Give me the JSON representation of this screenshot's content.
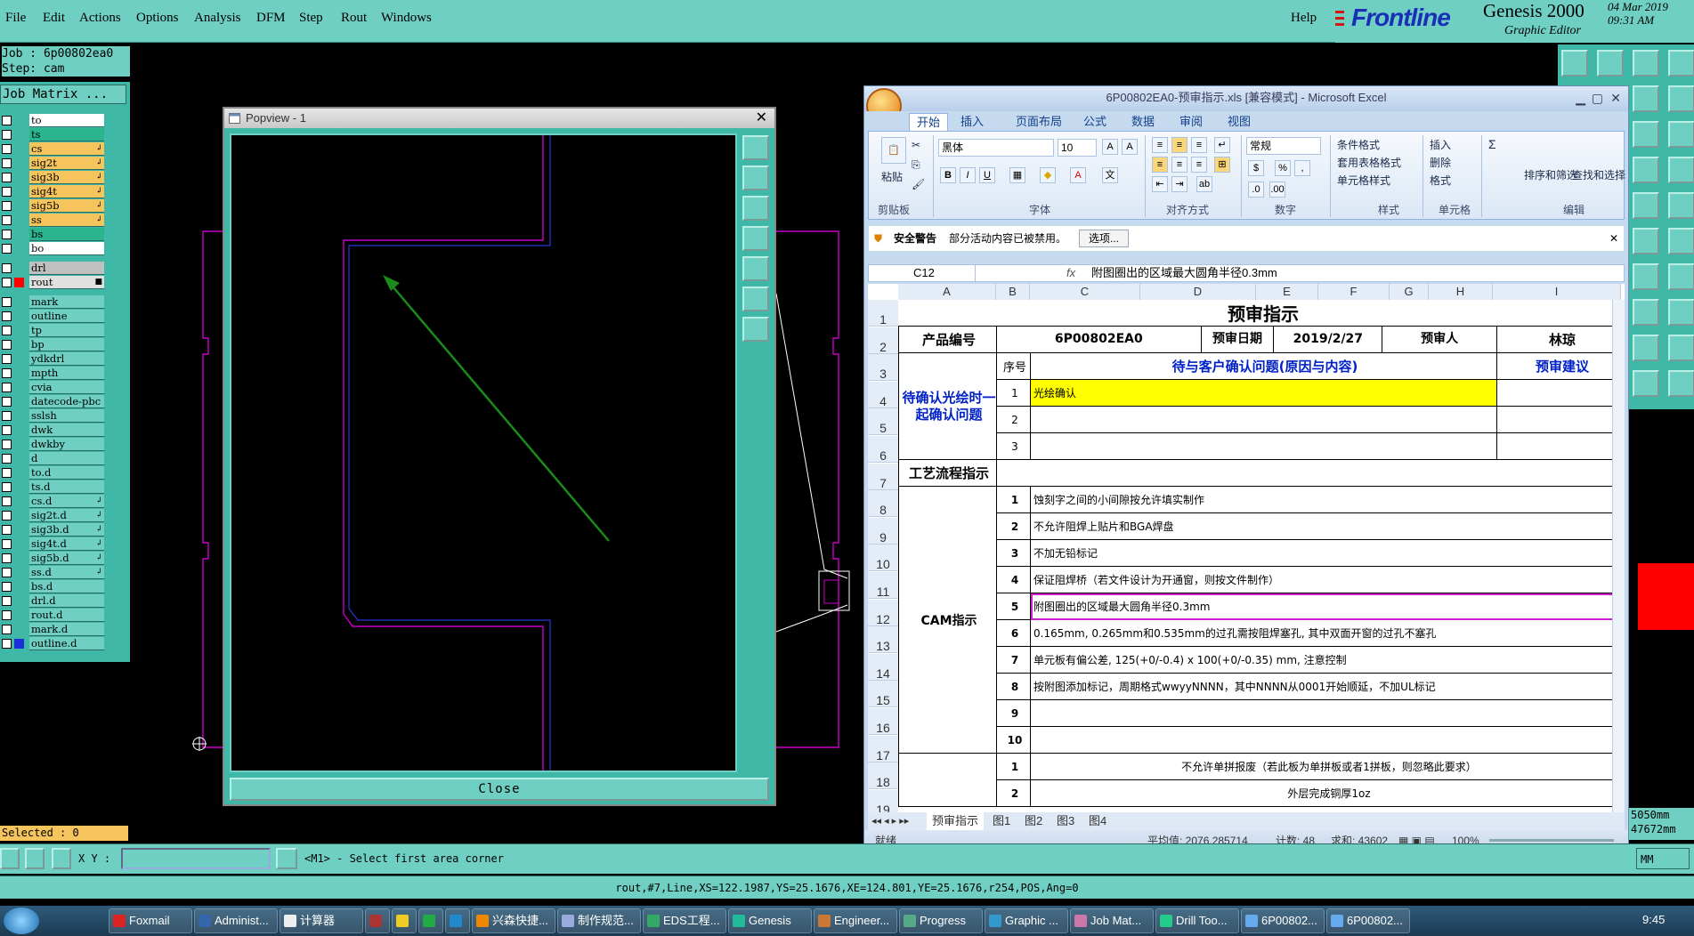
{
  "menubar": {
    "items": [
      "File",
      "Edit",
      "Actions",
      "Options",
      "Analysis",
      "DFM",
      "Step",
      "Rout",
      "Windows"
    ],
    "help": "Help"
  },
  "brand": {
    "frontline": "Frontline",
    "genesis": "Genesis 2000",
    "subtitle": "Graphic Editor",
    "date": "04 Mar 2019",
    "time": "09:31 AM"
  },
  "job": {
    "job_label": "Job : 6p00802ea0",
    "step_label": "Step: cam",
    "matrix_button": "Job Matrix ..."
  },
  "layers": [
    {
      "name": "to",
      "color": "#ffffff",
      "flag": ""
    },
    {
      "name": "ts",
      "color": "#2bb58f",
      "flag": ""
    },
    {
      "name": "cs",
      "color": "#f5c45c",
      "flag": "↲"
    },
    {
      "name": "sig2t",
      "color": "#f5c45c",
      "flag": "↲"
    },
    {
      "name": "sig3b",
      "color": "#f5c45c",
      "flag": "↲"
    },
    {
      "name": "sig4t",
      "color": "#f5c45c",
      "flag": "↲"
    },
    {
      "name": "sig5b",
      "color": "#f5c45c",
      "flag": "↲"
    },
    {
      "name": "ss",
      "color": "#f5c45c",
      "flag": "↲"
    },
    {
      "name": "bs",
      "color": "#2bb58f",
      "flag": ""
    },
    {
      "name": "bo",
      "color": "#ffffff",
      "flag": ""
    },
    {
      "name": "drl",
      "color": "#c0c0c0",
      "flag": ""
    },
    {
      "name": "rout",
      "color": "#e0e0e0",
      "flag": "■"
    },
    {
      "name": "mark",
      "color": "#6ecfc2",
      "flag": ""
    },
    {
      "name": "outline",
      "color": "#6ecfc2",
      "flag": ""
    },
    {
      "name": "tp",
      "color": "#6ecfc2",
      "flag": ""
    },
    {
      "name": "bp",
      "color": "#6ecfc2",
      "flag": ""
    },
    {
      "name": "ydkdrl",
      "color": "#6ecfc2",
      "flag": ""
    },
    {
      "name": "mpth",
      "color": "#6ecfc2",
      "flag": ""
    },
    {
      "name": "cvia",
      "color": "#6ecfc2",
      "flag": ""
    },
    {
      "name": "datecode-pbc",
      "color": "#6ecfc2",
      "flag": ""
    },
    {
      "name": "sslsh",
      "color": "#6ecfc2",
      "flag": ""
    },
    {
      "name": "dwk",
      "color": "#6ecfc2",
      "flag": ""
    },
    {
      "name": "dwkby",
      "color": "#6ecfc2",
      "flag": ""
    },
    {
      "name": "d",
      "color": "#6ecfc2",
      "flag": ""
    },
    {
      "name": "to.d",
      "color": "#6ecfc2",
      "flag": ""
    },
    {
      "name": "ts.d",
      "color": "#6ecfc2",
      "flag": ""
    },
    {
      "name": "cs.d",
      "color": "#6ecfc2",
      "flag": "↲"
    },
    {
      "name": "sig2t.d",
      "color": "#6ecfc2",
      "flag": "↲"
    },
    {
      "name": "sig3b.d",
      "color": "#6ecfc2",
      "flag": "↲"
    },
    {
      "name": "sig4t.d",
      "color": "#6ecfc2",
      "flag": "↲"
    },
    {
      "name": "sig5b.d",
      "color": "#6ecfc2",
      "flag": "↲"
    },
    {
      "name": "ss.d",
      "color": "#6ecfc2",
      "flag": "↲"
    },
    {
      "name": "bs.d",
      "color": "#6ecfc2",
      "flag": ""
    },
    {
      "name": "drl.d",
      "color": "#6ecfc2",
      "flag": ""
    },
    {
      "name": "rout.d",
      "color": "#6ecfc2",
      "flag": ""
    },
    {
      "name": "mark.d",
      "color": "#6ecfc2",
      "flag": ""
    },
    {
      "name": "outline.d",
      "color": "#6ecfc2",
      "flag": ""
    }
  ],
  "selected": "Selected : 0",
  "popview": {
    "title": "Popview - 1",
    "close_button": "Close"
  },
  "excel": {
    "title": "6P00802EA0-预审指示.xls  [兼容模式]  -  Microsoft Excel",
    "tabs": [
      "开始",
      "插入",
      "页面布局",
      "公式",
      "数据",
      "审阅",
      "视图"
    ],
    "ribbon": {
      "paste": "粘贴",
      "clipboard": "剪贴板",
      "font_name": "黑体",
      "font_size": "10",
      "font_group": "字体",
      "align_group": "对齐方式",
      "number_format": "常规",
      "number_group": "数字",
      "cond_format": "条件格式",
      "table_format": "套用表格格式",
      "cell_style": "单元格样式",
      "style_group": "样式",
      "insert": "插入",
      "delete": "删除",
      "format": "格式",
      "cells_group": "单元格",
      "sort_filter": "排序和筛选",
      "find_select": "查找和选择",
      "edit_group": "编辑"
    },
    "security": {
      "label": "安全警告",
      "message": "部分活动内容已被禁用。",
      "options_button": "选项..."
    },
    "name_box": "C12",
    "formula": "附图圈出的区域最大圆角半径0.3mm",
    "columns": [
      "A",
      "B",
      "C",
      "D",
      "E",
      "F",
      "G",
      "H",
      "I"
    ],
    "sheet": {
      "title": "预审指示",
      "product_label": "产品编号",
      "product_value": "6P00802EA0",
      "date_label": "预审日期",
      "date_value": "2019/2/27",
      "reviewer_label": "预审人",
      "reviewer_value": "林琼",
      "seq_header": "序号",
      "issue_header": "待与客户确认问题(原因与内容)",
      "suggest_header": "预审建议",
      "pending_label": "待确认光绘时一起确认问题",
      "pending_rows": [
        {
          "n": "1",
          "text": "光绘确认"
        },
        {
          "n": "2",
          "text": ""
        },
        {
          "n": "3",
          "text": ""
        }
      ],
      "process_label": "工艺流程指示",
      "cam_label": "CAM指示",
      "cam_rows": [
        {
          "n": "1",
          "text": "蚀刻字之间的小间隙按允许填实制作"
        },
        {
          "n": "2",
          "text": "不允许阻焊上贴片和BGA焊盘"
        },
        {
          "n": "3",
          "text": "不加无铅标记"
        },
        {
          "n": "4",
          "text": "保证阻焊桥（若文件设计为开通窗，则按文件制作）"
        },
        {
          "n": "5",
          "text": "附图圈出的区域最大圆角半径0.3mm"
        },
        {
          "n": "6",
          "text": "0.165mm, 0.265mm和0.535mm的过孔需按阻焊塞孔, 其中双面开窗的过孔不塞孔"
        },
        {
          "n": "7",
          "text": "单元板有偏公差, 125(+0/-0.4) x 100(+0/-0.35) mm, 注意控制"
        },
        {
          "n": "8",
          "text": "按附图添加标记，周期格式wwyyNNNN，其中NNNN从0001开始顺延，不加UL标记"
        },
        {
          "n": "9",
          "text": ""
        },
        {
          "n": "10",
          "text": ""
        }
      ],
      "extra_rows": [
        {
          "n": "1",
          "text": "不允许单拼报废（若此板为单拼板或者1拼板，则忽略此要求）"
        },
        {
          "n": "2",
          "text": "外层完成铜厚1oz"
        }
      ],
      "row_numbers": [
        "1",
        "2",
        "3",
        "4",
        "5",
        "6",
        "7",
        "8",
        "9",
        "10",
        "11",
        "12",
        "13",
        "14",
        "15",
        "16",
        "17",
        "18",
        "19"
      ]
    },
    "sheet_tabs": [
      "预审指示",
      "图1",
      "图2",
      "图3",
      "图4"
    ],
    "status": {
      "ready": "就绪",
      "average": "平均值: 2076.285714",
      "count": "计数: 48",
      "sum": "求和: 43602",
      "zoom": "100%"
    }
  },
  "right_status": {
    "line1": "5050mm",
    "line2": "47672mm"
  },
  "command": {
    "xy_label": "X Y :",
    "xy_value": "",
    "prompt": "<M1> - Select first area corner",
    "units": "MM"
  },
  "info_line": "rout,#7,Line,XS=122.1987,YS=25.1676,XE=124.801,YE=25.1676,r254,POS,Ang=0",
  "taskbar": {
    "items": [
      "Foxmail",
      "Administ...",
      "计算器",
      "",
      "",
      "",
      "",
      "兴森快捷...",
      "制作规范...",
      "EDS工程...",
      "Genesis",
      "Engineer...",
      "Progress",
      "Graphic ...",
      "Job Mat...",
      "Drill Too...",
      "6P00802...",
      "6P00802..."
    ],
    "clock": "9:45"
  },
  "colors": {
    "teal": "#6ecfc2",
    "teal_dark": "#3fb8a7",
    "outline_magenta": "#c800c8",
    "arrow_green": "#1a8a1a",
    "highlight_yellow": "#ffff00",
    "excel_blue": "#0020c8"
  }
}
